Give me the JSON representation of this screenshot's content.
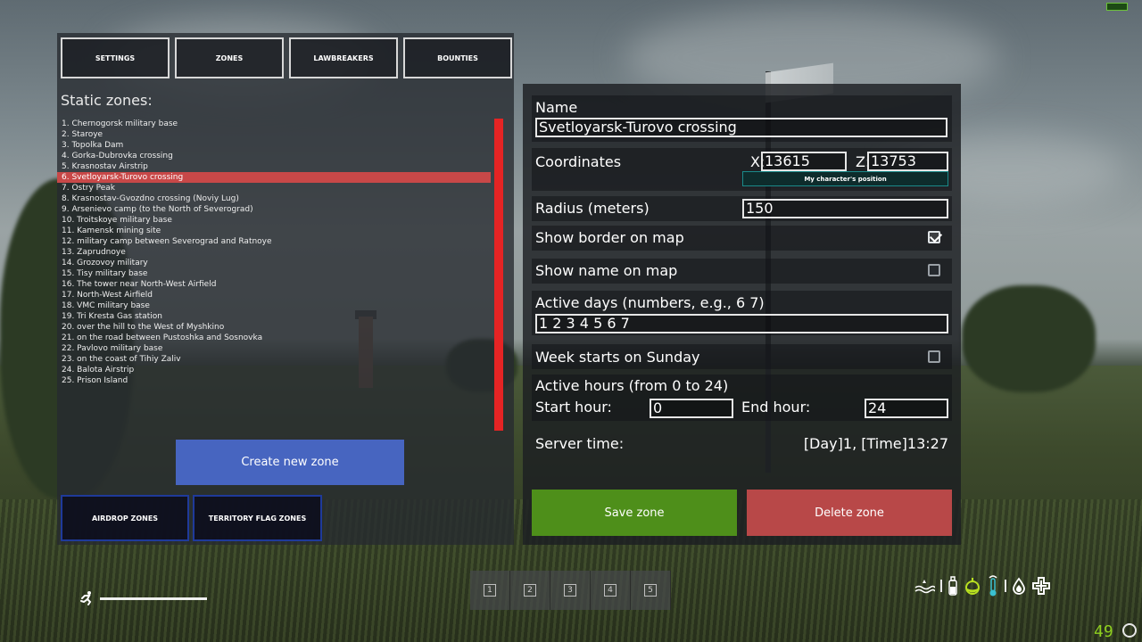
{
  "tabs": [
    "SETTINGS",
    "ZONES",
    "LAWBREAKERS",
    "BOUNTIES"
  ],
  "static_zones": {
    "title": "Static zones:",
    "selected_index": 5,
    "items": [
      "1. Chernogorsk military base",
      "2. Staroye",
      "3. Topolka Dam",
      "4. Gorka-Dubrovka crossing",
      "5. Krasnostav Airstrip",
      "6. Svetloyarsk-Turovo crossing",
      "7. Ostry Peak",
      "8. Krasnostav-Gvozdno crossing (Noviy Lug)",
      "9. Arsenievo camp (to the North of Severograd)",
      "10. Troitskoye military base",
      "11. Kamensk mining site",
      "12. military camp between Severograd and Ratnoye",
      "13. Zaprudnoye",
      "14. Grozovoy military",
      "15. Tisy military base",
      "16. The tower near North-West Airfield",
      "17. North-West Airfield",
      "18. VMC military base",
      "19. Tri Kresta Gas station",
      "20. over the hill to the West of Myshkino",
      "21. on the road between Pustoshka and Sosnovka",
      "22. Pavlovo military base",
      "23. on the coast of Tihiy Zaliv",
      "24. Balota Airstrip",
      "25. Prison Island"
    ]
  },
  "create_button": "Create new zone",
  "sub_tabs": [
    "AIRDROP ZONES",
    "TERRITORY FLAG ZONES"
  ],
  "form": {
    "name_label": "Name",
    "name_value": "Svetloyarsk-Turovo crossing",
    "coordinates_label": "Coordinates",
    "x_label": "X:",
    "x_value": "13615",
    "z_label": "Z:",
    "z_value": "13753",
    "my_position_button": "My character's position",
    "radius_label": "Radius (meters)",
    "radius_value": "150",
    "show_border_label": "Show border on map",
    "show_border_checked": true,
    "show_name_label": "Show name on map",
    "show_name_checked": false,
    "active_days_label": "Active days (numbers, e.g., 6 7)",
    "active_days_value": "1 2 3 4 5 6 7",
    "week_starts_label": "Week starts on Sunday",
    "week_starts_checked": false,
    "active_hours_label": "Active hours (from 0 to 24)",
    "start_hour_label": "Start hour:",
    "start_hour_value": "0",
    "end_hour_label": "End hour:",
    "end_hour_value": "24",
    "server_time_label": "Server time:",
    "server_time_value": "[Day]1, [Time]13:27",
    "save_button": "Save zone",
    "delete_button": "Delete zone"
  },
  "hotbar": [
    "1",
    "2",
    "3",
    "4",
    "5"
  ],
  "hud": {
    "fps": "49",
    "stamina_icon": "running-man-icon",
    "status_icons": [
      "water-icon",
      "bottle-icon",
      "apple-icon",
      "thermometer-icon",
      "blood-drop-icon",
      "health-cross-icon"
    ]
  },
  "colors": {
    "selected_row": "#c84848",
    "scrollbar": "#e52424",
    "create_button": "#4765c0",
    "save_button": "#4e8f1a",
    "delete_button": "#b84848",
    "fps": "#8fd01f"
  }
}
